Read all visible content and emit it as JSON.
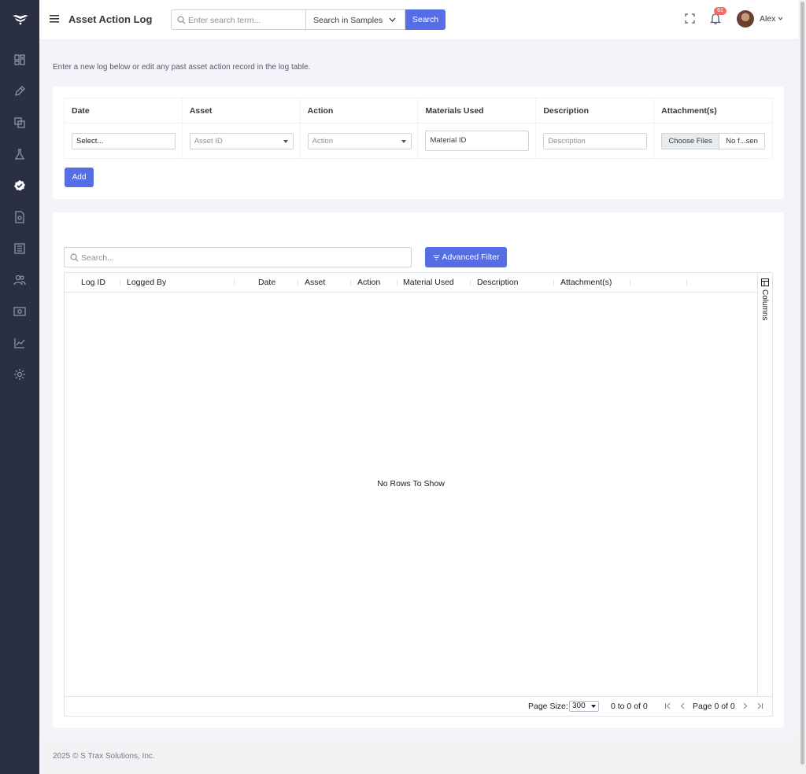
{
  "topbar": {
    "title": "Asset Action Log",
    "search_placeholder": "Enter search term...",
    "search_scope": "Search in Samples",
    "search_button": "Search",
    "notification_count": "61",
    "user_name": "Alex"
  },
  "sidebar": {
    "items": [
      "dashboard-icon",
      "pencil-icon",
      "copy-icon",
      "flask-icon",
      "check-badge-icon",
      "document-icon",
      "list-icon",
      "users-icon",
      "money-icon",
      "chart-icon",
      "gear-icon"
    ],
    "active": "check-badge-icon"
  },
  "intro_text": "Enter a new log below or edit any past asset action record in the log table.",
  "entry_form": {
    "headers": [
      "Date",
      "Asset",
      "Action",
      "Materials Used",
      "Description",
      "Attachment(s)"
    ],
    "date_value": "Select...",
    "asset_placeholder": "Asset ID",
    "action_placeholder": "Action",
    "material_value": "Material ID",
    "description_placeholder": "Description",
    "file_button": "Choose Files",
    "file_status": "No f...sen",
    "add_button": "Add"
  },
  "log_grid": {
    "search_placeholder": "Search...",
    "advanced_filter": "Advanced Filter",
    "columns": [
      "Log ID",
      "Logged By",
      "Date",
      "Asset",
      "Action",
      "Material Used",
      "Description",
      "Attachment(s)"
    ],
    "side_panel_label": "Columns",
    "empty_message": "No Rows To Show",
    "page_size_label": "Page Size:",
    "page_size": "300",
    "row_count": "0 to 0 of 0",
    "page_info": "Page 0 of 0"
  },
  "footer": "2025 © S Trax Solutions, Inc.",
  "colors": {
    "sidebar": "#2a3042",
    "primary": "#556ee6",
    "badge": "#f46a6a"
  }
}
